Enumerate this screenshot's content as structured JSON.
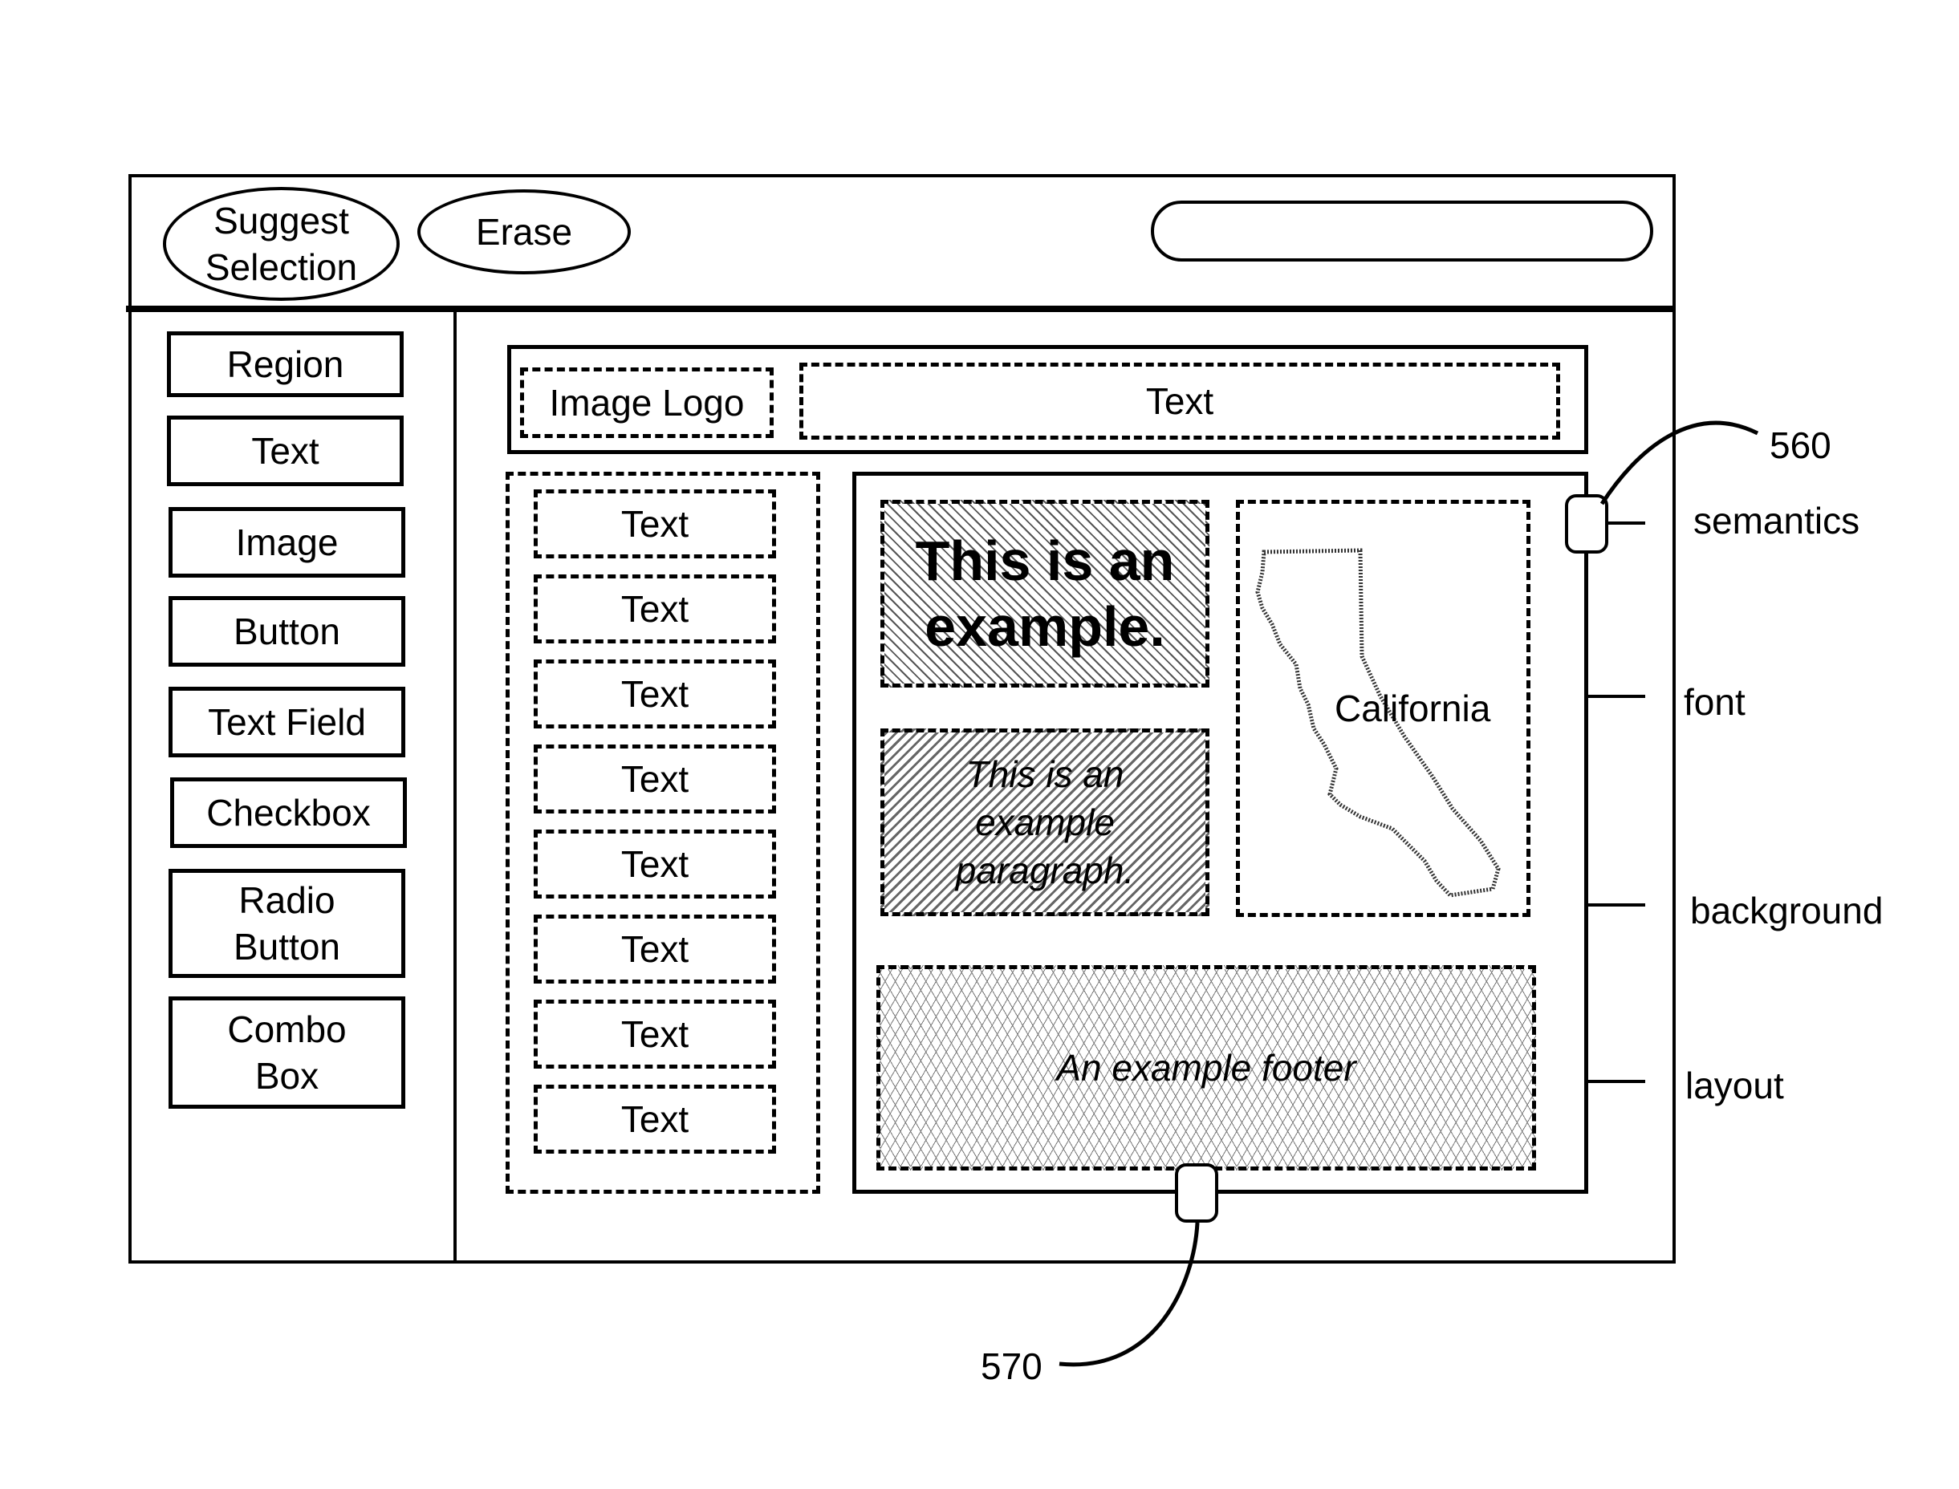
{
  "toolbar": {
    "suggest_selection_label": "Suggest\nSelection",
    "erase_label": "Erase",
    "search_value": ""
  },
  "sidebar": {
    "items": [
      {
        "label": "Region"
      },
      {
        "label": "Text"
      },
      {
        "label": "Image"
      },
      {
        "label": "Button"
      },
      {
        "label": "Text Field"
      },
      {
        "label": "Checkbox"
      },
      {
        "label": "Radio\nButton"
      },
      {
        "label": "Combo\nBox"
      }
    ]
  },
  "canvas": {
    "banner": {
      "logo_label": "Image Logo",
      "text_label": "Text"
    },
    "list_items": [
      "Text",
      "Text",
      "Text",
      "Text",
      "Text",
      "Text",
      "Text",
      "Text"
    ],
    "content": {
      "heading": "This is an example.",
      "paragraph": "This is an example paragraph.",
      "map_label": "California",
      "footer": "An example footer"
    }
  },
  "slider_560": {
    "reference": "560",
    "ticks": [
      "semantics",
      "font",
      "background",
      "layout"
    ],
    "selected": "semantics"
  },
  "slider_570": {
    "reference": "570"
  }
}
